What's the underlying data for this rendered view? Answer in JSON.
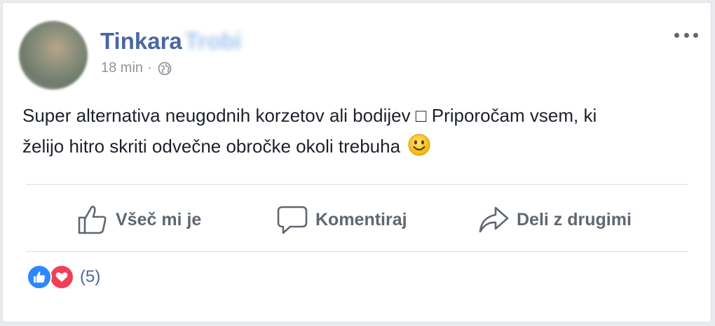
{
  "post": {
    "author_first": "Tinkara",
    "author_last": "Trobi",
    "time": "18 min",
    "separator": "·",
    "privacy_icon": "globe-icon",
    "text_line1": "Super alternativa neugodnih korzetov ali bodijev □ Priporočam vsem, ki",
    "text_line2": "želijo hitro skriti odvečne obročke okoli trebuha",
    "emoji": "slightly-smiling-face"
  },
  "actions": {
    "like": "Všeč mi je",
    "comment": "Komentiraj",
    "share": "Deli z drugimi"
  },
  "reactions": {
    "types": [
      "like",
      "love"
    ],
    "count": "(5)"
  },
  "colors": {
    "author": "#4b67a1",
    "like": "#2d88ff",
    "love": "#f33e58",
    "action_text": "#606770",
    "meta": "#90949c"
  }
}
